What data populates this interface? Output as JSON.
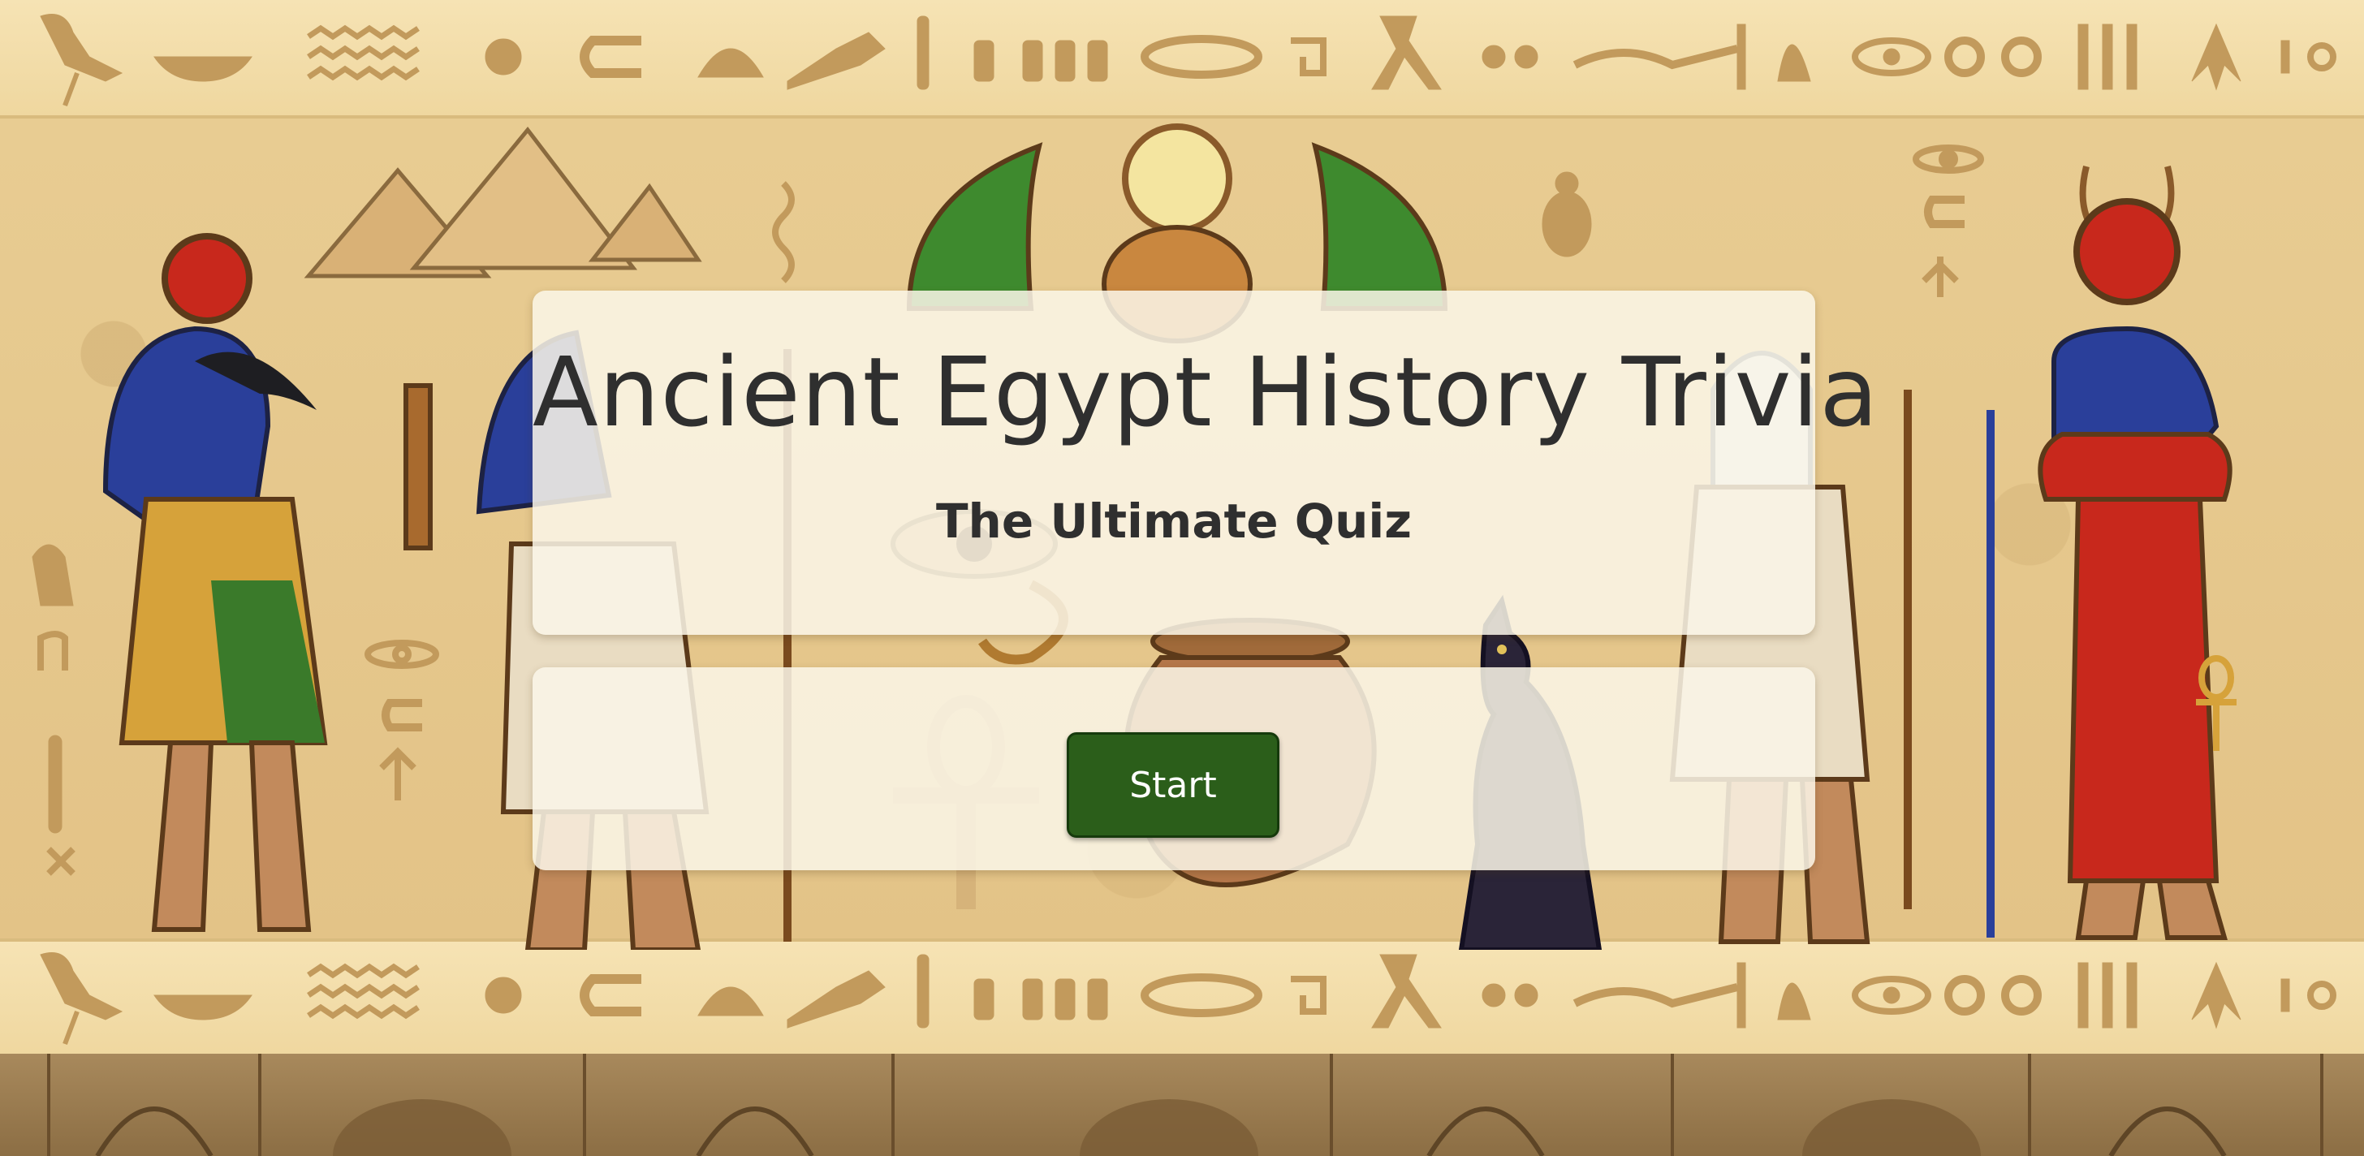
{
  "game": {
    "title": "Ancient Egypt History Trivia",
    "subtitle": "The Ultimate Quiz",
    "start_label": "Start"
  },
  "theme": {
    "background": "#e9cf9a",
    "band_light": "#f6e3b4",
    "hieroglyph_color": "#c29a5c",
    "panel_color": "#faf6e8",
    "text_color": "#2f2f2f",
    "button_color": "#2b5e1a",
    "button_text_color": "#ffffff"
  },
  "decorations": {
    "icons": [
      "ibis-icon",
      "boat-icon",
      "water-icon",
      "vulture-icon",
      "rope-icon",
      "eye-icon",
      "ankh-icon",
      "scarab-icon",
      "pyramid-icon",
      "sun-disk-icon",
      "winged-scarab-icon",
      "cat-statue-icon",
      "vase-icon",
      "eye-of-horus-icon",
      "thoth-figure-icon",
      "anubis-figure-icon",
      "pharaoh-figure-icon",
      "isis-figure-icon"
    ]
  }
}
